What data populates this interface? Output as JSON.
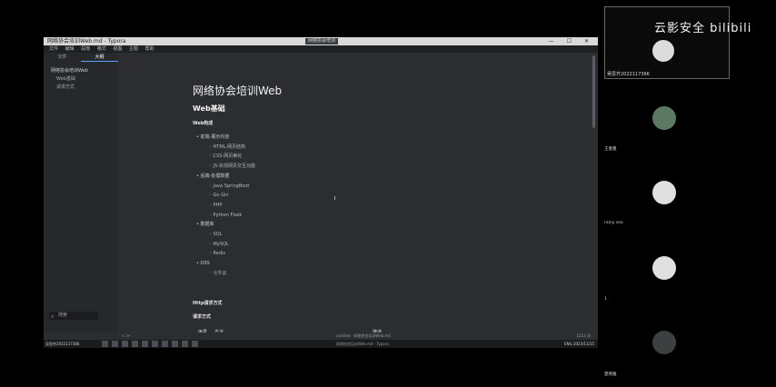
{
  "window": {
    "title": "网络协会培训Web.md - Typora",
    "tab_label": "网络协会培训",
    "controls": [
      "—",
      "☐",
      "✕"
    ]
  },
  "menubar": [
    "文件",
    "编辑",
    "段落",
    "格式",
    "视图",
    "主题",
    "帮助"
  ],
  "sidebar": {
    "tabs": [
      "文件",
      "大纲"
    ],
    "active_tab": "大纲",
    "items": [
      {
        "label": "网络协会培训Web",
        "level": 1
      },
      {
        "label": "Web基础",
        "level": 2
      },
      {
        "label": "请求方式",
        "level": 2
      }
    ],
    "search_placeholder": "搜索"
  },
  "doc": {
    "title": "网络协会培训Web",
    "h2": "Web基础",
    "h3": "Web构成",
    "outline": [
      {
        "text": "前端-展示内容",
        "level": 1
      },
      {
        "text": "HTML-网页结构",
        "level": 2
      },
      {
        "text": "CSS-网页美化",
        "level": 2
      },
      {
        "text": "JS-实现网页交互功能",
        "level": 2
      },
      {
        "text": "后端-处理数据",
        "level": 1
      },
      {
        "text": "Java SpringBoot",
        "level": 2
      },
      {
        "text": "Go Gin",
        "level": 2
      },
      {
        "text": "PHP",
        "level": 2
      },
      {
        "text": "Python Flask",
        "level": 2
      },
      {
        "text": "数据库",
        "level": 1
      },
      {
        "text": "SQL",
        "level": 2
      },
      {
        "text": "MySQL",
        "level": 2
      },
      {
        "text": "Redis",
        "level": 2
      },
      {
        "text": "OSS",
        "level": 1
      },
      {
        "text": "七牛云",
        "level": 2
      }
    ],
    "h4_a": "Http请求方式",
    "h4_b": "请求方式",
    "table_headers": [
      "序号",
      "方法",
      "描述"
    ]
  },
  "statusbar": {
    "left": "<  />",
    "middle": "untitled - 网络协会培训Web.md",
    "right": "1213 词"
  },
  "taskbar": {
    "left": "吴思齐2022117366",
    "middle": "网络协会培训Web.md - Typora",
    "tray": "ENG  2023/11/15"
  },
  "participants": {
    "caster_name": "吴思齐2022117366",
    "watermark": "云影安全 bilibili",
    "people": [
      {
        "name": "王墨鑫",
        "style": "green"
      },
      {
        "name": "rainy sea",
        "style": "plain"
      },
      {
        "name": "1",
        "style": "plain"
      },
      {
        "name": "夏明雅",
        "style": "photo"
      }
    ]
  }
}
